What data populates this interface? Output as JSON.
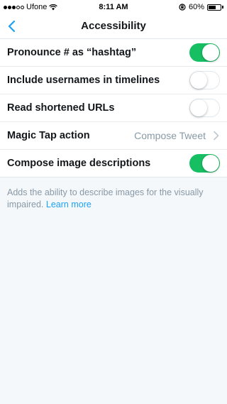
{
  "status_bar": {
    "carrier": "Ufone",
    "time": "8:11 AM",
    "battery_percent": "60%",
    "battery_level": 0.6
  },
  "nav": {
    "title": "Accessibility",
    "back_icon": "chevron-left-icon"
  },
  "settings": [
    {
      "label": "Pronounce # as “hashtag”",
      "type": "toggle",
      "on": true
    },
    {
      "label": "Include usernames in timelines",
      "type": "toggle",
      "on": false
    },
    {
      "label": "Read shortened URLs",
      "type": "toggle",
      "on": false
    },
    {
      "label": "Magic Tap action",
      "type": "value",
      "value": "Compose Tweet"
    },
    {
      "label": "Compose image descriptions",
      "type": "toggle",
      "on": true
    }
  ],
  "footer": {
    "description": "Adds the ability to describe images for the visually impaired.",
    "link_label": "Learn more"
  },
  "colors": {
    "accent": "#1da1f2",
    "toggle_on": "#17bf63",
    "secondary_text": "#8899a6"
  }
}
